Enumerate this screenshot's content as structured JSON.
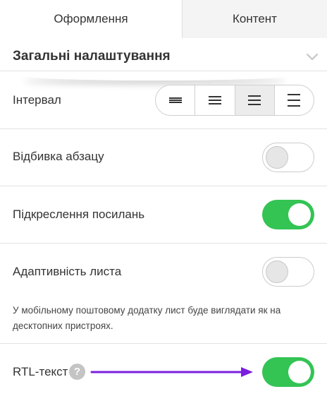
{
  "tabs": [
    {
      "label": "Оформлення",
      "active": true
    },
    {
      "label": "Контент",
      "active": false
    }
  ],
  "section": {
    "title": "Загальні налаштування",
    "collapse_icon": "chevron-down-icon"
  },
  "settings": {
    "interval": {
      "label": "Інтервал",
      "options": [
        "line-spacing-tight-icon",
        "line-spacing-small-icon",
        "line-spacing-medium-icon",
        "line-spacing-large-icon"
      ],
      "selected_index": 2
    },
    "paragraph_spacing": {
      "label": "Відбивка абзацу",
      "enabled": false
    },
    "link_underline": {
      "label": "Підкреслення посилань",
      "enabled": true
    },
    "adaptive": {
      "label": "Адаптивність листа",
      "enabled": false,
      "hint": "У мобільному поштовому додатку лист буде виглядати як на десктопних пристроях."
    },
    "rtl": {
      "label": "RTL-текст",
      "enabled": true,
      "help_icon": "?"
    }
  },
  "colors": {
    "toggle_on": "#33c453",
    "arrow": "#7b1fe0"
  }
}
